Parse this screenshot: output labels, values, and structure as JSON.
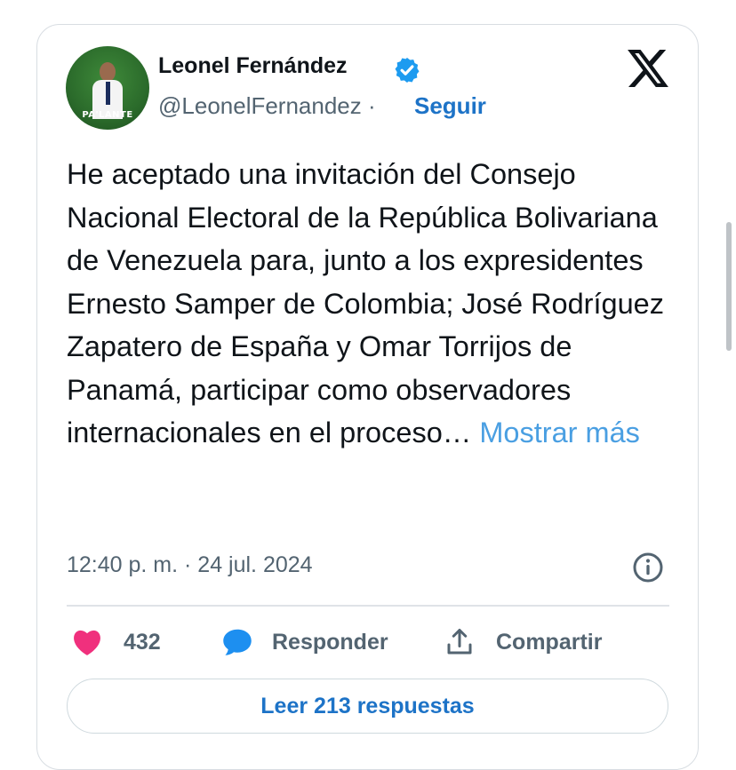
{
  "author": {
    "name": "Leonel Fernández",
    "handle": "@LeonelFernandez",
    "separator": "·",
    "follow_label": "Seguir",
    "avatar_text": "PA'LANTE"
  },
  "tweet": {
    "text": "He aceptado una invitación del Consejo Nacional Electoral de la República Bolivariana de Venezuela para, junto a los expresidentes Ernesto Samper de Colombia; José Rodríguez Zapatero de España y Omar Torrijos de Panamá, participar como observadores internacionales en el proceso…",
    "show_more": "Mostrar más",
    "timestamp": "12:40 p. m. · 24 jul. 2024"
  },
  "actions": {
    "like_count": "432",
    "reply_label": "Responder",
    "share_label": "Compartir"
  },
  "read_replies": "Leer 213 respuestas",
  "colors": {
    "link": "#1d73c7",
    "show_more": "#4a9fe2",
    "like": "#f0307d",
    "reply_icon": "#1d8ff0",
    "verified": "#1d9bf0"
  },
  "icons": [
    "verified-badge-icon",
    "x-logo-icon",
    "info-icon",
    "heart-icon",
    "chat-bubble-icon",
    "share-icon"
  ]
}
